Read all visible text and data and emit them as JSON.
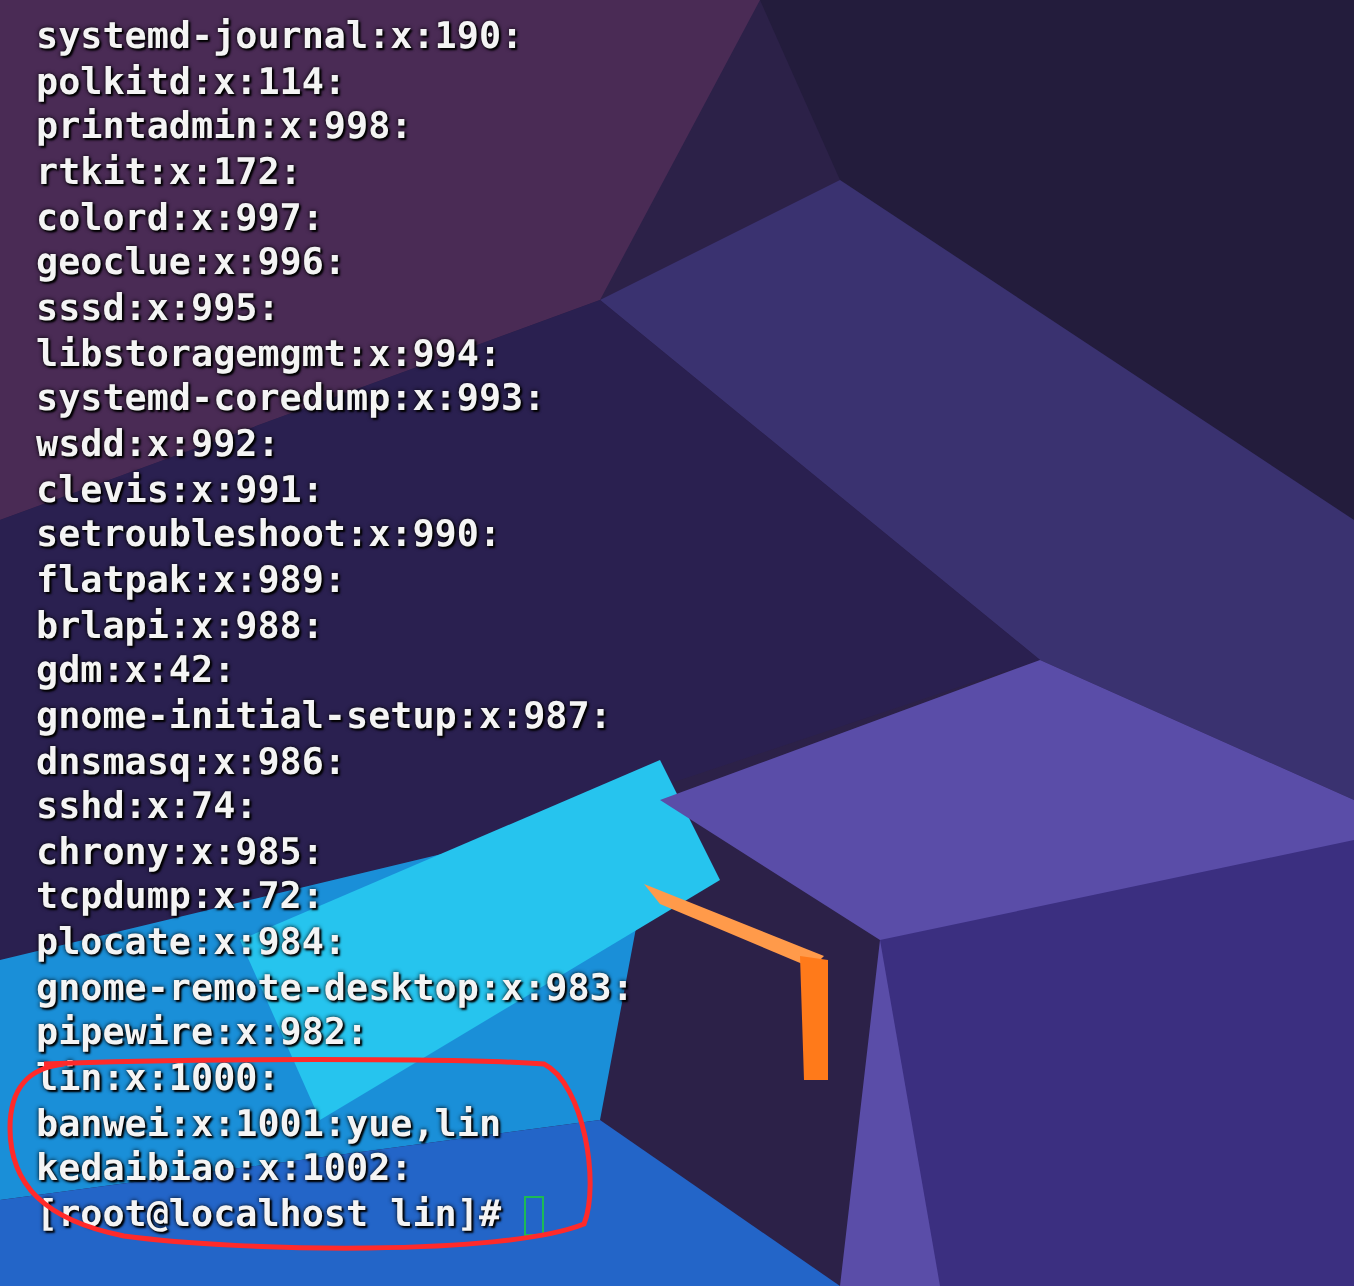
{
  "terminal": {
    "lines": [
      "systemd-journal:x:190:",
      "polkitd:x:114:",
      "printadmin:x:998:",
      "rtkit:x:172:",
      "colord:x:997:",
      "geoclue:x:996:",
      "sssd:x:995:",
      "libstoragemgmt:x:994:",
      "systemd-coredump:x:993:",
      "wsdd:x:992:",
      "clevis:x:991:",
      "setroubleshoot:x:990:",
      "flatpak:x:989:",
      "brlapi:x:988:",
      "gdm:x:42:",
      "gnome-initial-setup:x:987:",
      "dnsmasq:x:986:",
      "sshd:x:74:",
      "chrony:x:985:",
      "tcpdump:x:72:",
      "plocate:x:984:",
      "gnome-remote-desktop:x:983:",
      "pipewire:x:982:",
      "lin:x:1000:",
      "banwei:x:1001:yue,lin",
      "kedaibiao:x:1002:"
    ],
    "prompt": "[root@localhost lin]#"
  }
}
